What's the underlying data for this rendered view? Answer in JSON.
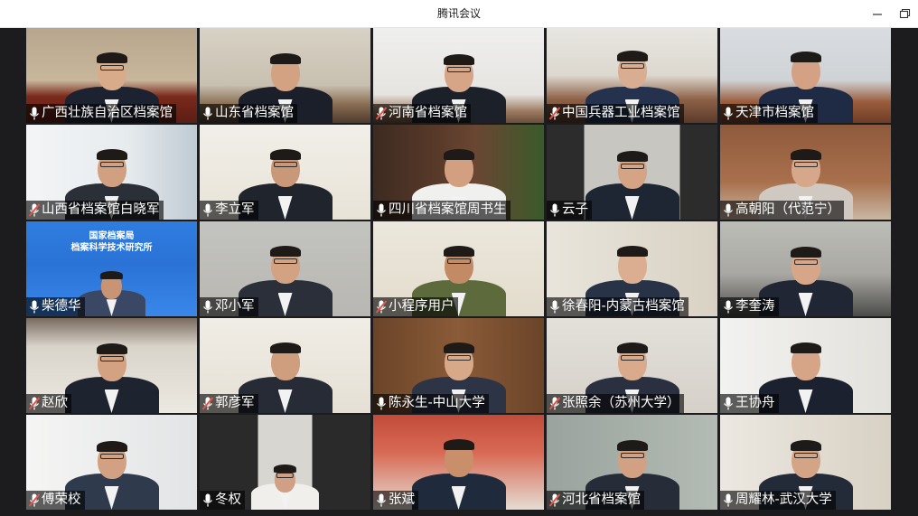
{
  "window": {
    "title": "腾讯会议",
    "minimize_icon": "minimize-icon",
    "restore_icon": "restore-icon"
  },
  "colors": {
    "active_speaker_border": "#33c25e",
    "muted_mic": "#e25548",
    "label_bg": "rgba(0,0,0,0.62)"
  },
  "participants": [
    {
      "name": "广西壮族自治区档案馆",
      "mic": "on",
      "scene": "office-red"
    },
    {
      "name": "山东省档案馆",
      "mic": "on",
      "scene": "painting"
    },
    {
      "name": "河南省档案馆",
      "mic": "muted",
      "scene": "white-wall"
    },
    {
      "name": "中国兵器工业档案馆",
      "mic": "muted",
      "scene": "meeting-room"
    },
    {
      "name": "天津市档案馆",
      "mic": "on",
      "scene": "meeting-room-2"
    },
    {
      "name": "山西省档案馆白晓军",
      "mic": "muted",
      "scene": "bright-room"
    },
    {
      "name": "李立军",
      "mic": "on",
      "scene": "calligraphy"
    },
    {
      "name": "四川省档案馆周书生",
      "mic": "on",
      "scene": "bookshelf-dark"
    },
    {
      "name": "云子",
      "mic": "on",
      "scene": "dark-frame"
    },
    {
      "name": "高朝阳（代范宁）",
      "mic": "on",
      "scene": "brown-wall"
    },
    {
      "name": "柴德华",
      "mic": "on",
      "scene": "blue-banner",
      "banner": [
        "国家档案局",
        "档案科学技术研究所"
      ]
    },
    {
      "name": "邓小军",
      "mic": "on",
      "scene": "grey-room"
    },
    {
      "name": "小程序用户",
      "mic": "muted",
      "scene": "landscape-frame"
    },
    {
      "name": "徐春阳-内蒙古档案馆",
      "mic": "on",
      "scene": "shelves-light"
    },
    {
      "name": "李奎涛",
      "mic": "on",
      "scene": "grey-office",
      "active": true
    },
    {
      "name": "赵欣",
      "mic": "muted",
      "scene": "calligraphy-2"
    },
    {
      "name": "郭彦军",
      "mic": "muted",
      "scene": "calligraphy-3"
    },
    {
      "name": "陈永生-中山大学",
      "mic": "on",
      "scene": "bookshelf-wood"
    },
    {
      "name": "张照余（苏州大学）",
      "mic": "muted",
      "scene": "office-light"
    },
    {
      "name": "王协舟",
      "mic": "on",
      "scene": "office-white"
    },
    {
      "name": "傅荣校",
      "mic": "muted",
      "scene": "white-room"
    },
    {
      "name": "冬权",
      "mic": "on",
      "scene": "dark-frame-2"
    },
    {
      "name": "张斌",
      "mic": "on",
      "scene": "university-bg"
    },
    {
      "name": "河北省档案馆",
      "mic": "muted",
      "scene": "archive-cabinet"
    },
    {
      "name": "周耀林-武汉大学",
      "mic": "on",
      "scene": "shelves-white"
    }
  ]
}
